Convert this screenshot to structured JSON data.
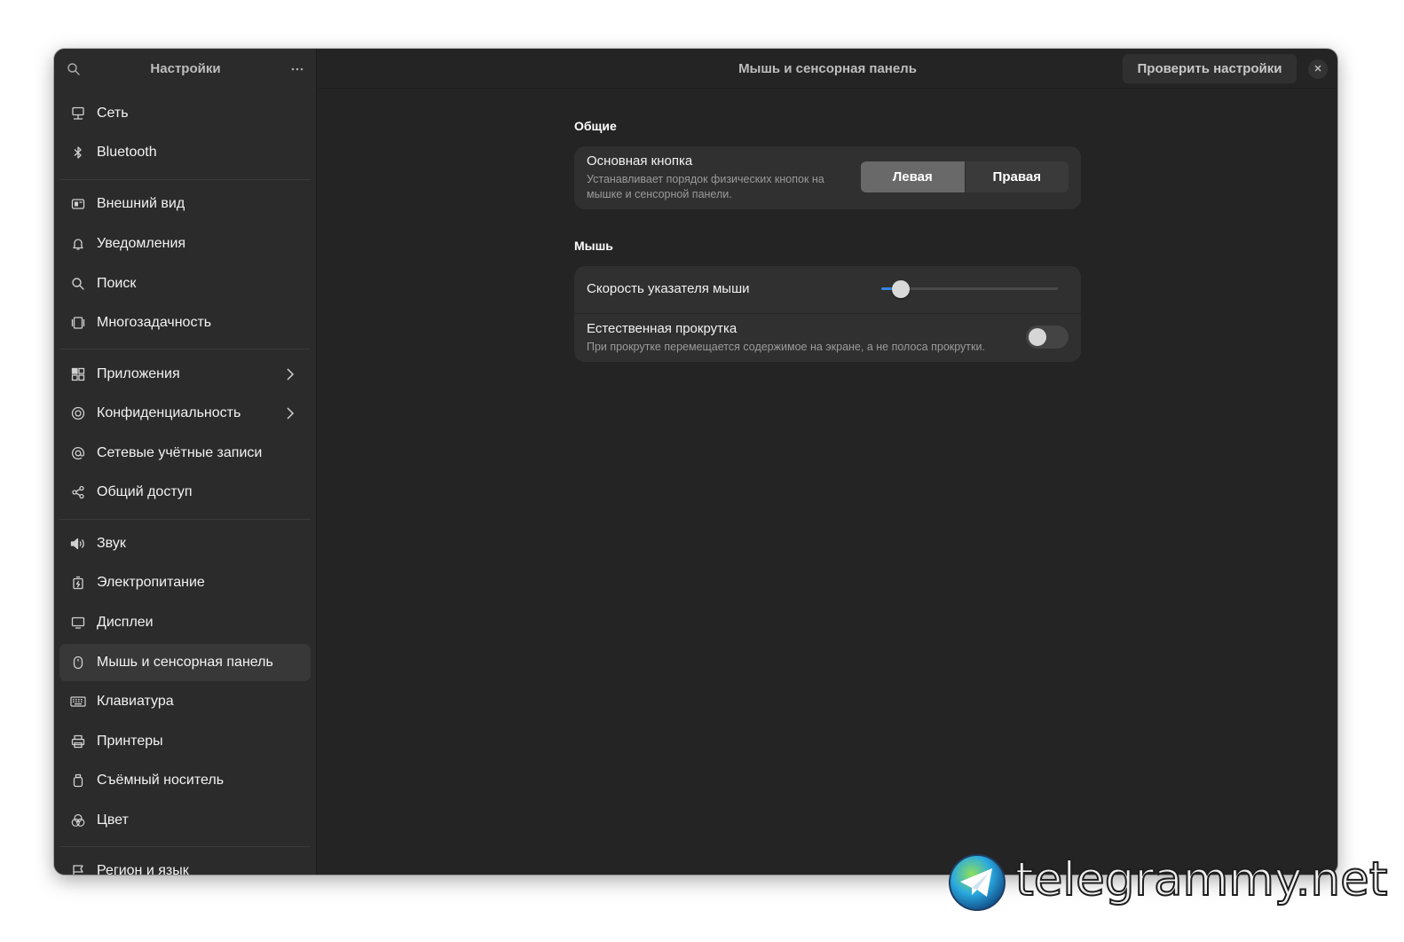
{
  "sidebar": {
    "title": "Настройки",
    "items": [
      {
        "label": "Сеть",
        "icon": "network-icon"
      },
      {
        "label": "Bluetooth",
        "icon": "bluetooth-icon"
      },
      {
        "label": "Внешний вид",
        "icon": "appearance-icon"
      },
      {
        "label": "Уведомления",
        "icon": "bell-icon"
      },
      {
        "label": "Поиск",
        "icon": "search-icon"
      },
      {
        "label": "Многозадачность",
        "icon": "multitasking-icon"
      },
      {
        "label": "Приложения",
        "icon": "apps-icon",
        "has_submenu": true
      },
      {
        "label": "Конфиденциальность",
        "icon": "privacy-icon",
        "has_submenu": true
      },
      {
        "label": "Сетевые учётные записи",
        "icon": "at-icon"
      },
      {
        "label": "Общий доступ",
        "icon": "share-icon"
      },
      {
        "label": "Звук",
        "icon": "speaker-icon"
      },
      {
        "label": "Электропитание",
        "icon": "power-icon"
      },
      {
        "label": "Дисплеи",
        "icon": "display-icon"
      },
      {
        "label": "Мышь и сенсорная панель",
        "icon": "mouse-icon",
        "active": true
      },
      {
        "label": "Клавиатура",
        "icon": "keyboard-icon"
      },
      {
        "label": "Принтеры",
        "icon": "printer-icon"
      },
      {
        "label": "Съёмный носитель",
        "icon": "removable-media-icon"
      },
      {
        "label": "Цвет",
        "icon": "color-icon"
      },
      {
        "label": "Регион и язык",
        "icon": "flag-icon"
      }
    ]
  },
  "header": {
    "title": "Мышь и сенсорная панель",
    "test_button": "Проверить настройки"
  },
  "general": {
    "section_title": "Общие",
    "primary_button": {
      "title": "Основная кнопка",
      "subtitle_line1": "Устанавливает порядок физических кнопок на",
      "subtitle_line2": "мышке и сенсорной панели.",
      "options": [
        "Левая",
        "Правая"
      ],
      "selected": "Левая"
    }
  },
  "mouse": {
    "section_title": "Мышь",
    "pointer_speed": {
      "title": "Скорость указателя мыши",
      "value": 0.11
    },
    "natural_scroll": {
      "title": "Естественная прокрутка",
      "subtitle": "При прокрутке перемещается содержимое на экране, а не полоса прокрутки.",
      "enabled": false
    }
  },
  "watermark": {
    "text": "telegrammy.net"
  },
  "colors": {
    "accent": "#3584e4",
    "window_bg": "#242424",
    "sidebar_bg": "#2b2b2b",
    "card_bg": "#303030"
  }
}
